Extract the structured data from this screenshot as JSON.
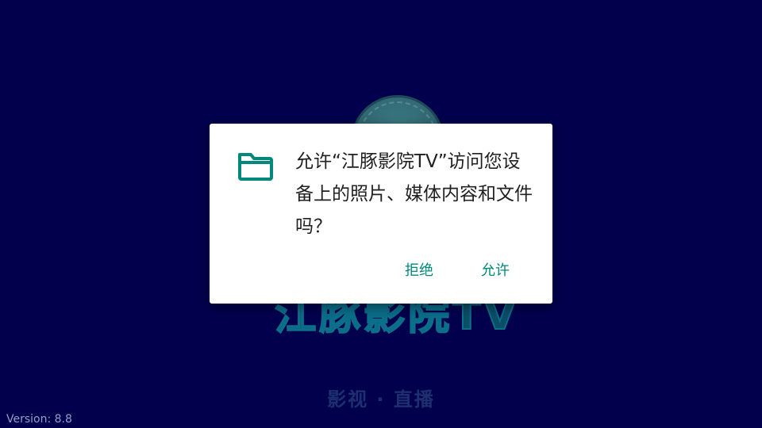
{
  "splash": {
    "app_title": "江豚影院TV",
    "slogan": "影视 · 直播",
    "version": "Version: 8.8"
  },
  "permission_dialog": {
    "icon": "folder-icon",
    "message": "允许“江豚影院TV”访问您设备上的照片、媒体内容和文件吗？",
    "deny_label": "拒绝",
    "allow_label": "允许",
    "accent_color": "#00897b"
  },
  "colors": {
    "background": "#02004d",
    "dialog_background": "#ffffff",
    "text": "#212121"
  }
}
